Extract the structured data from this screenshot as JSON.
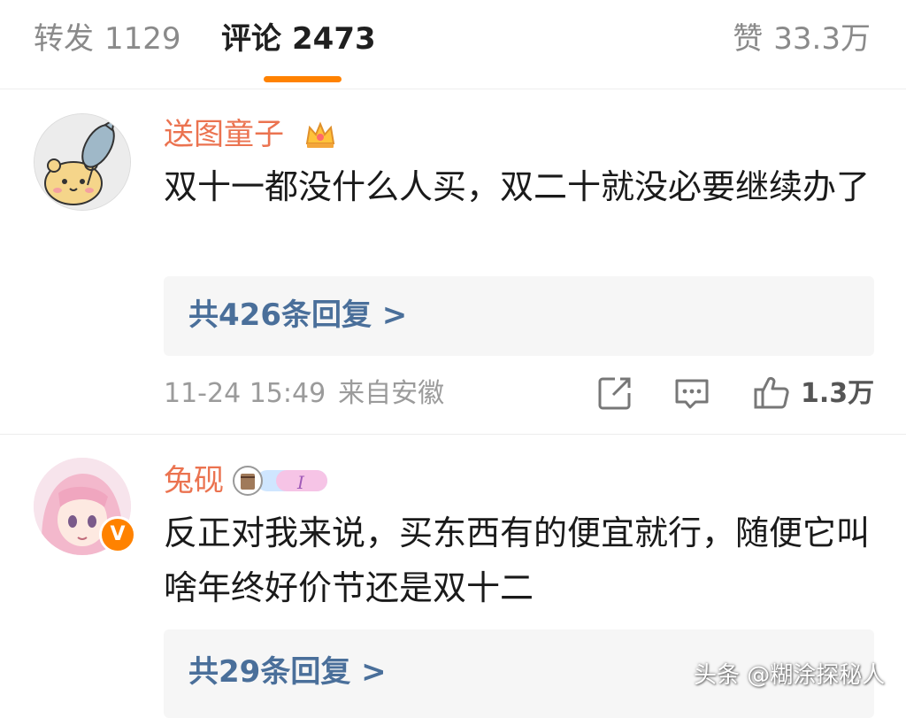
{
  "tabs": {
    "repost": {
      "label": "转发",
      "count": "1129"
    },
    "comment": {
      "label": "评论",
      "count": "2473"
    },
    "like": {
      "label": "赞",
      "count": "33.3万"
    }
  },
  "colors": {
    "accent": "#ff8200",
    "username": "#eb7350",
    "link": "#4a6f9a"
  },
  "comments": [
    {
      "username": "送图童子",
      "badge_icon": "crown-icon",
      "text": "双十一都没什么人买，双二十就没必要继续办了",
      "replies": "共426条回复 >",
      "time": "11-24 15:49",
      "location": "来自安徽",
      "likes": "1.3万"
    },
    {
      "username": "兔砚",
      "badge_icon": "medal-icon",
      "vip_mark": "V",
      "text": "反正对我来说，买东西有的便宜就行，随便它叫啥年终好价节还是双十二",
      "replies": "共29条回复 >"
    }
  ],
  "watermark": "头条 @糊涂探秘人"
}
